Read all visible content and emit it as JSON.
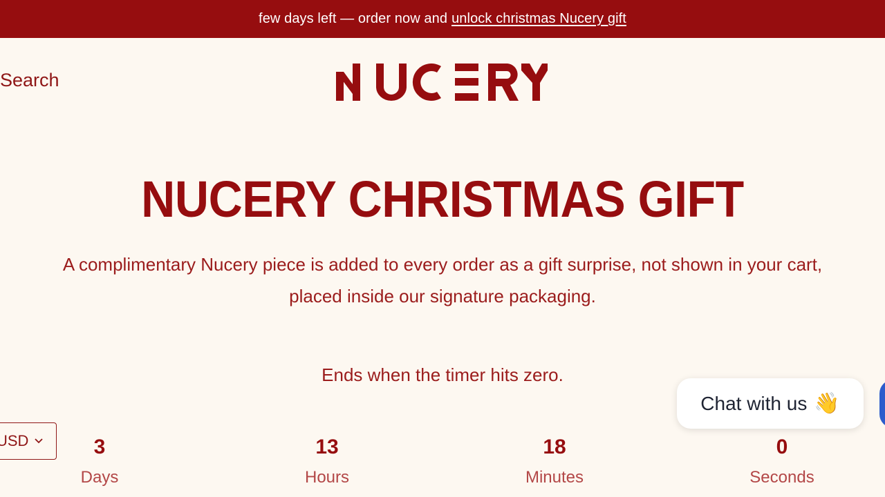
{
  "announcement": {
    "text": "few days left — order now and",
    "link": "unlock christmas Nucery gift",
    "bg_color": "#960d0f"
  },
  "header": {
    "search_label": "Search",
    "logo_text": "NUCERY"
  },
  "hero": {
    "title": "NUCERY CHRISTMAS GIFT",
    "description_line1": "A complimentary Nucery piece is added to every order as a gift surprise, not shown in your cart,",
    "description_line2": "placed inside our signature packaging.",
    "ends_text": "Ends when the timer hits zero."
  },
  "timer": [
    {
      "value": "3",
      "label": "Days"
    },
    {
      "value": "13",
      "label": "Hours"
    },
    {
      "value": "18",
      "label": "Minutes"
    },
    {
      "value": "0",
      "label": "Seconds"
    }
  ],
  "currency": {
    "selected": "USD",
    "icon": "chevron-down-icon"
  },
  "chat": {
    "label": "Chat with us",
    "emoji": "👋"
  },
  "colors": {
    "brand": "#960d0f",
    "background": "#fdf8f1",
    "chat_accent": "#2c5ccc"
  }
}
